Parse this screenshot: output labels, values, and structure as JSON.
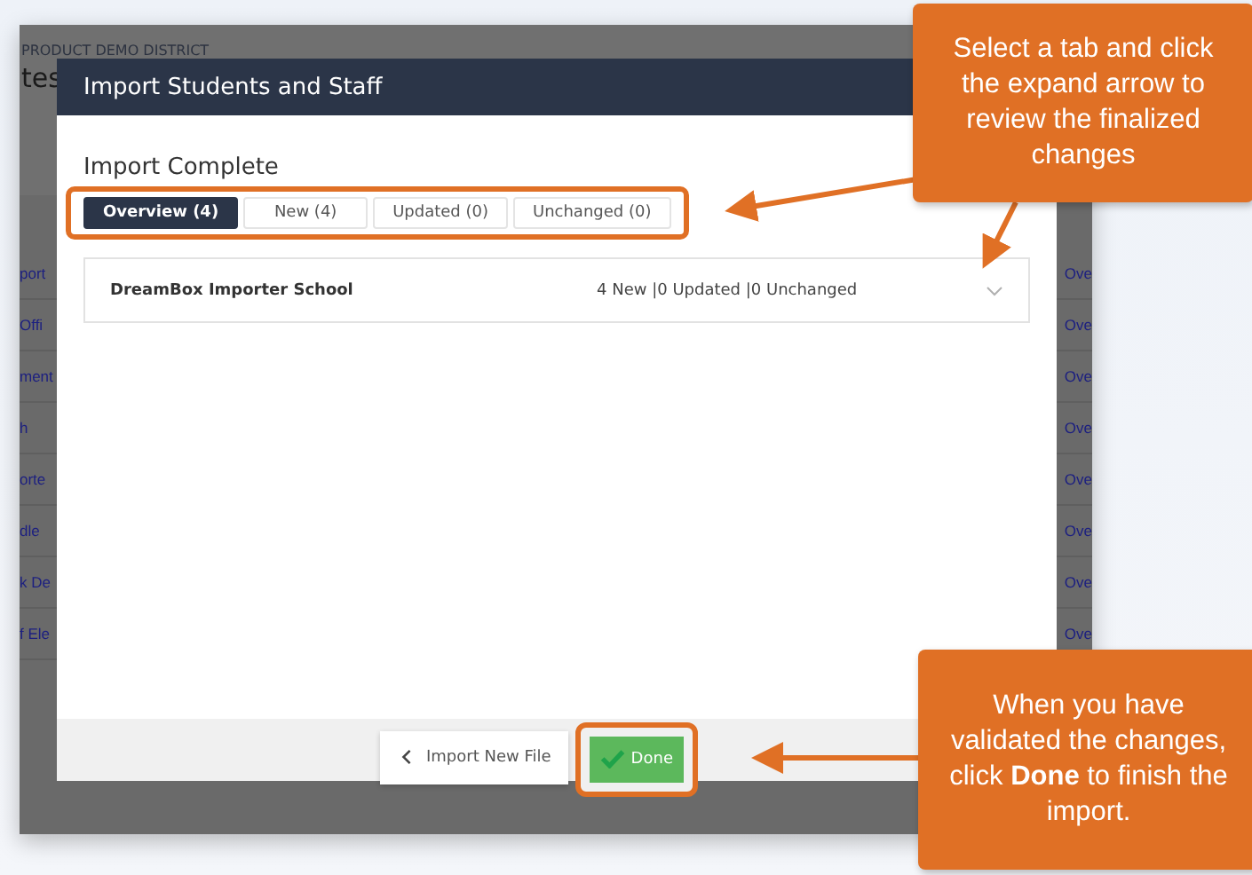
{
  "background_page": {
    "district": "PRODUCT DEMO DISTRICT",
    "title_fragment": "tes",
    "rows": [
      {
        "left": "port",
        "right": "Ove"
      },
      {
        "left": "Offi",
        "right": "Ove"
      },
      {
        "left": "ment",
        "right": "Ove"
      },
      {
        "left": "h",
        "right": "Ove"
      },
      {
        "left": "orte",
        "right": "Ove"
      },
      {
        "left": "dle",
        "right": "Ove"
      },
      {
        "left": "k De",
        "right": "Ove"
      },
      {
        "left": "f Ele",
        "right": "Ove"
      }
    ]
  },
  "dialog": {
    "title": "Import Students and Staff",
    "heading": "Import Complete",
    "tabs": [
      {
        "label": "Overview (4)",
        "selected": true
      },
      {
        "label": "New (4)",
        "selected": false
      },
      {
        "label": "Updated (0)",
        "selected": false
      },
      {
        "label": "Unchanged (0)",
        "selected": false
      }
    ],
    "rows": [
      {
        "name": "DreamBox Importer School",
        "summary": "4 New |0 Updated |0 Unchanged",
        "expanded": false
      }
    ],
    "buttons": [
      {
        "label": "Import New File",
        "kind": "back"
      },
      {
        "label": "Done",
        "kind": "primary"
      }
    ]
  },
  "callouts": [
    {
      "text": "Select a tab and click the expand arrow to review the finalized changes"
    },
    {
      "text": "When you have validated the changes, click **Done** to finish the import."
    }
  ]
}
